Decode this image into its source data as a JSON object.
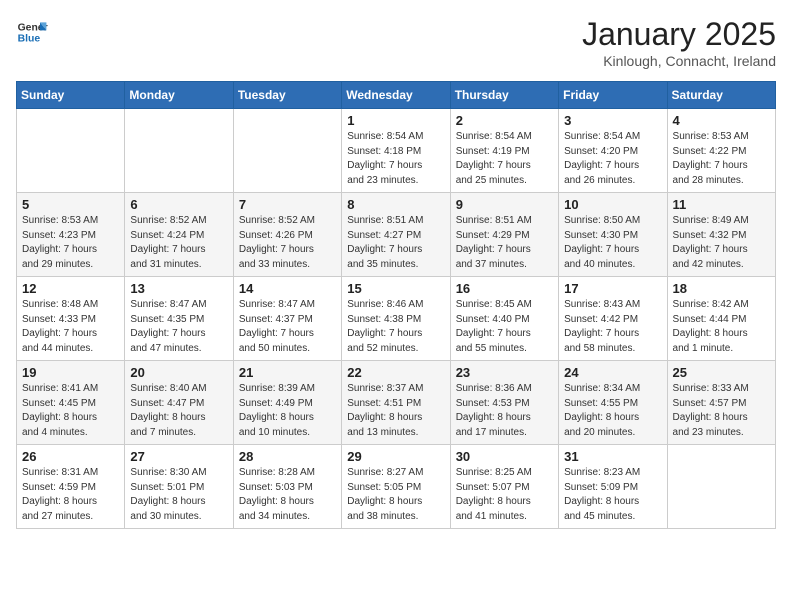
{
  "logo": {
    "line1": "General",
    "line2": "Blue"
  },
  "title": "January 2025",
  "location": "Kinlough, Connacht, Ireland",
  "weekdays": [
    "Sunday",
    "Monday",
    "Tuesday",
    "Wednesday",
    "Thursday",
    "Friday",
    "Saturday"
  ],
  "weeks": [
    [
      {
        "day": "",
        "info": ""
      },
      {
        "day": "",
        "info": ""
      },
      {
        "day": "",
        "info": ""
      },
      {
        "day": "1",
        "info": "Sunrise: 8:54 AM\nSunset: 4:18 PM\nDaylight: 7 hours\nand 23 minutes."
      },
      {
        "day": "2",
        "info": "Sunrise: 8:54 AM\nSunset: 4:19 PM\nDaylight: 7 hours\nand 25 minutes."
      },
      {
        "day": "3",
        "info": "Sunrise: 8:54 AM\nSunset: 4:20 PM\nDaylight: 7 hours\nand 26 minutes."
      },
      {
        "day": "4",
        "info": "Sunrise: 8:53 AM\nSunset: 4:22 PM\nDaylight: 7 hours\nand 28 minutes."
      }
    ],
    [
      {
        "day": "5",
        "info": "Sunrise: 8:53 AM\nSunset: 4:23 PM\nDaylight: 7 hours\nand 29 minutes."
      },
      {
        "day": "6",
        "info": "Sunrise: 8:52 AM\nSunset: 4:24 PM\nDaylight: 7 hours\nand 31 minutes."
      },
      {
        "day": "7",
        "info": "Sunrise: 8:52 AM\nSunset: 4:26 PM\nDaylight: 7 hours\nand 33 minutes."
      },
      {
        "day": "8",
        "info": "Sunrise: 8:51 AM\nSunset: 4:27 PM\nDaylight: 7 hours\nand 35 minutes."
      },
      {
        "day": "9",
        "info": "Sunrise: 8:51 AM\nSunset: 4:29 PM\nDaylight: 7 hours\nand 37 minutes."
      },
      {
        "day": "10",
        "info": "Sunrise: 8:50 AM\nSunset: 4:30 PM\nDaylight: 7 hours\nand 40 minutes."
      },
      {
        "day": "11",
        "info": "Sunrise: 8:49 AM\nSunset: 4:32 PM\nDaylight: 7 hours\nand 42 minutes."
      }
    ],
    [
      {
        "day": "12",
        "info": "Sunrise: 8:48 AM\nSunset: 4:33 PM\nDaylight: 7 hours\nand 44 minutes."
      },
      {
        "day": "13",
        "info": "Sunrise: 8:47 AM\nSunset: 4:35 PM\nDaylight: 7 hours\nand 47 minutes."
      },
      {
        "day": "14",
        "info": "Sunrise: 8:47 AM\nSunset: 4:37 PM\nDaylight: 7 hours\nand 50 minutes."
      },
      {
        "day": "15",
        "info": "Sunrise: 8:46 AM\nSunset: 4:38 PM\nDaylight: 7 hours\nand 52 minutes."
      },
      {
        "day": "16",
        "info": "Sunrise: 8:45 AM\nSunset: 4:40 PM\nDaylight: 7 hours\nand 55 minutes."
      },
      {
        "day": "17",
        "info": "Sunrise: 8:43 AM\nSunset: 4:42 PM\nDaylight: 7 hours\nand 58 minutes."
      },
      {
        "day": "18",
        "info": "Sunrise: 8:42 AM\nSunset: 4:44 PM\nDaylight: 8 hours\nand 1 minute."
      }
    ],
    [
      {
        "day": "19",
        "info": "Sunrise: 8:41 AM\nSunset: 4:45 PM\nDaylight: 8 hours\nand 4 minutes."
      },
      {
        "day": "20",
        "info": "Sunrise: 8:40 AM\nSunset: 4:47 PM\nDaylight: 8 hours\nand 7 minutes."
      },
      {
        "day": "21",
        "info": "Sunrise: 8:39 AM\nSunset: 4:49 PM\nDaylight: 8 hours\nand 10 minutes."
      },
      {
        "day": "22",
        "info": "Sunrise: 8:37 AM\nSunset: 4:51 PM\nDaylight: 8 hours\nand 13 minutes."
      },
      {
        "day": "23",
        "info": "Sunrise: 8:36 AM\nSunset: 4:53 PM\nDaylight: 8 hours\nand 17 minutes."
      },
      {
        "day": "24",
        "info": "Sunrise: 8:34 AM\nSunset: 4:55 PM\nDaylight: 8 hours\nand 20 minutes."
      },
      {
        "day": "25",
        "info": "Sunrise: 8:33 AM\nSunset: 4:57 PM\nDaylight: 8 hours\nand 23 minutes."
      }
    ],
    [
      {
        "day": "26",
        "info": "Sunrise: 8:31 AM\nSunset: 4:59 PM\nDaylight: 8 hours\nand 27 minutes."
      },
      {
        "day": "27",
        "info": "Sunrise: 8:30 AM\nSunset: 5:01 PM\nDaylight: 8 hours\nand 30 minutes."
      },
      {
        "day": "28",
        "info": "Sunrise: 8:28 AM\nSunset: 5:03 PM\nDaylight: 8 hours\nand 34 minutes."
      },
      {
        "day": "29",
        "info": "Sunrise: 8:27 AM\nSunset: 5:05 PM\nDaylight: 8 hours\nand 38 minutes."
      },
      {
        "day": "30",
        "info": "Sunrise: 8:25 AM\nSunset: 5:07 PM\nDaylight: 8 hours\nand 41 minutes."
      },
      {
        "day": "31",
        "info": "Sunrise: 8:23 AM\nSunset: 5:09 PM\nDaylight: 8 hours\nand 45 minutes."
      },
      {
        "day": "",
        "info": ""
      }
    ]
  ]
}
